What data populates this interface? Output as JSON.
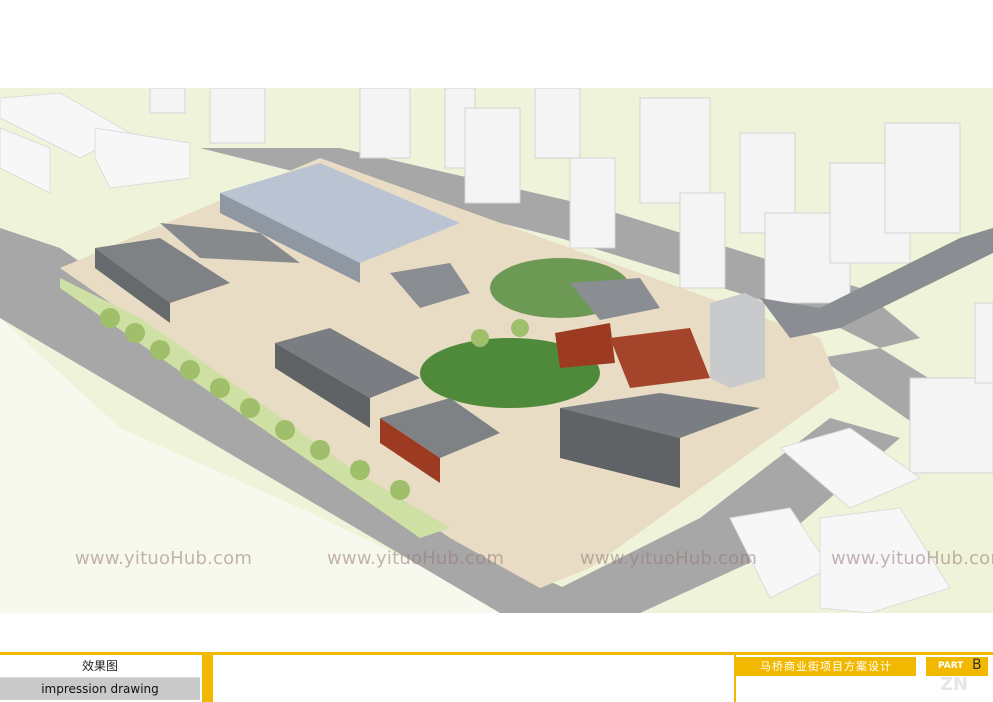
{
  "watermarks": [
    "www.yituoHub.com",
    "www.yituoHub.com",
    "www.yituoHub.com",
    "www.yituoHub.com"
  ],
  "footer": {
    "label_cn": "效果图",
    "label_en": "impression drawing",
    "project_title": "马桥商业街项目方案设计",
    "part_label": "PART",
    "part_letter": "B"
  },
  "colors": {
    "accent": "#f2b800",
    "grass": "#dde9b8",
    "road": "#a9a9a9",
    "plaza": "#e8dcc4",
    "roof_gray": "#7e8285",
    "brick": "#9c3b22",
    "tower": "#f2f2f2"
  }
}
